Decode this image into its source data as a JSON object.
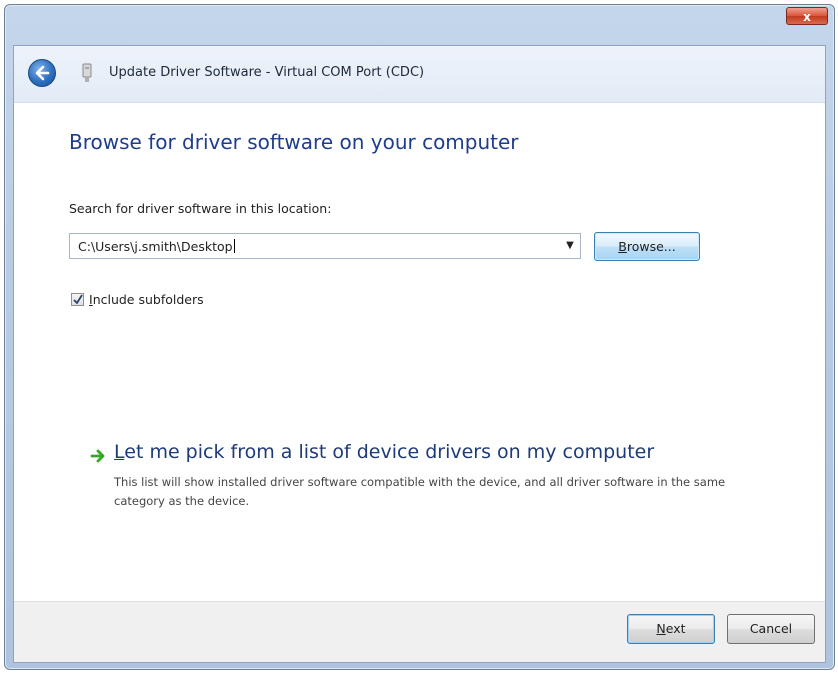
{
  "window": {
    "title": "Update Driver Software - Virtual COM Port (CDC)",
    "close_label": "x"
  },
  "page": {
    "heading": "Browse for driver software on your computer",
    "search_label": "Search for driver software in this location:",
    "path_value": "C:\\Users\\j.smith\\Desktop",
    "browse_button": {
      "underline": "B",
      "rest": "rowse..."
    },
    "include_subfolders": {
      "checked": true,
      "underline": "I",
      "rest": "nclude subfolders"
    },
    "pick_option": {
      "underline": "L",
      "rest": "et me pick from a list of device drivers on my computer",
      "description": "This list will show installed driver software compatible with the device, and all driver software in the same category as the device."
    }
  },
  "footer": {
    "next_button": {
      "underline": "N",
      "rest": "ext"
    },
    "cancel_button": "Cancel"
  },
  "icons": {
    "back": "back-arrow-icon",
    "device": "usb-device-icon",
    "pick_arrow": "green-arrow-icon",
    "dropdown": "chevron-down-icon",
    "checkmark": "checkmark-icon"
  },
  "colors": {
    "heading": "#1f3d8c",
    "link": "#1e3a78",
    "accent_arrow": "#3aa629",
    "close_button": "#c23a20"
  }
}
